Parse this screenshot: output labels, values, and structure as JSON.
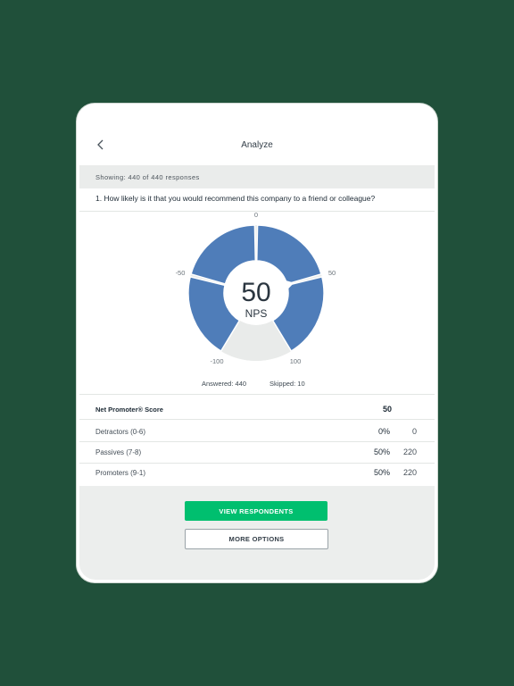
{
  "header": {
    "title": "Analyze",
    "back_icon": "chevron-left-icon"
  },
  "summary": {
    "showing": "Showing: 440 of 440 responses"
  },
  "question": {
    "text": "1. How likely is it that you would recommend this company to a friend or colleague?"
  },
  "chart_data": {
    "type": "gauge",
    "score": "50",
    "score_label": "NPS",
    "tick_labels": [
      "-100",
      "-50",
      "0",
      "50",
      "100"
    ],
    "segments": [
      {
        "name": "Detractors",
        "percent": 0,
        "color": "#e9ebea"
      },
      {
        "name": "Passives",
        "percent": 50,
        "color": "#4f7db9"
      },
      {
        "name": "Promoters",
        "percent": 50,
        "color": "#4f7db9"
      }
    ],
    "answered": "Answered: 440",
    "skipped": "Skipped: 10"
  },
  "table": {
    "nps_label": "Net Promoter® Score",
    "nps_value": "50",
    "rows": [
      {
        "label": "Detractors (0-6)",
        "percent": "0%",
        "count": "0"
      },
      {
        "label": "Passives (7-8)",
        "percent": "50%",
        "count": "220"
      },
      {
        "label": "Promoters (9-1)",
        "percent": "50%",
        "count": "220"
      }
    ]
  },
  "actions": {
    "view_respondents": "VIEW RESPONDENTS",
    "more_options": "MORE OPTIONS"
  },
  "colors": {
    "background": "#20503a",
    "accent": "#00bf6f",
    "gauge_fill": "#4f7db9",
    "gauge_empty": "#e9ebea"
  }
}
